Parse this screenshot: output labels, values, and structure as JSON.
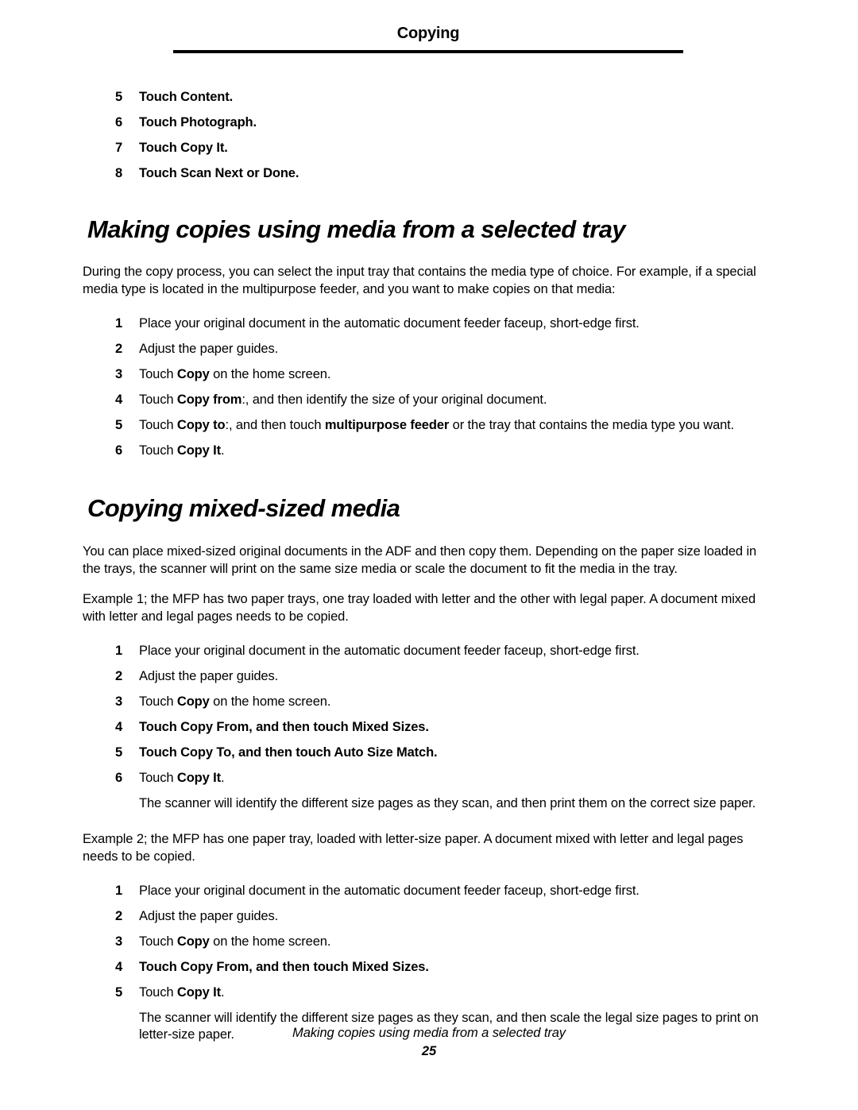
{
  "header": {
    "title": "Copying"
  },
  "top_steps": {
    "items": [
      {
        "num": "5",
        "parts": [
          {
            "t": "Touch ",
            "b": false
          },
          {
            "t": "Content",
            "b": true
          },
          {
            "t": ".",
            "b": false
          }
        ]
      },
      {
        "num": "6",
        "parts": [
          {
            "t": "Touch ",
            "b": false
          },
          {
            "t": "Photograph",
            "b": true
          },
          {
            "t": ".",
            "b": false
          }
        ]
      },
      {
        "num": "7",
        "parts": [
          {
            "t": "Touch ",
            "b": false
          },
          {
            "t": "Copy It",
            "b": true
          },
          {
            "t": ".",
            "b": false
          }
        ]
      },
      {
        "num": "8",
        "parts": [
          {
            "t": "Touch ",
            "b": true
          },
          {
            "t": "Scan Next",
            "b": true
          },
          {
            "t": " or ",
            "b": true
          },
          {
            "t": "Done",
            "b": true
          },
          {
            "t": ".",
            "b": true
          }
        ]
      }
    ]
  },
  "section_1": {
    "heading": "Making copies using media from a selected tray",
    "intro": "During the copy process, you can select the input tray that contains the media type of choice. For example, if a special media type is located in the multipurpose feeder, and you want to make copies on that media:",
    "steps": [
      {
        "num": "1",
        "parts": [
          {
            "t": "Place your original document in the automatic document feeder faceup, short-edge first.",
            "b": false
          }
        ]
      },
      {
        "num": "2",
        "parts": [
          {
            "t": "Adjust the paper guides.",
            "b": false
          }
        ]
      },
      {
        "num": "3",
        "parts": [
          {
            "t": "Touch ",
            "b": false
          },
          {
            "t": "Copy",
            "b": true
          },
          {
            "t": " on the home screen.",
            "b": false
          }
        ]
      },
      {
        "num": "4",
        "parts": [
          {
            "t": "Touch ",
            "b": false
          },
          {
            "t": "Copy from",
            "b": true
          },
          {
            "t": ":, and then identify the size of your original document.",
            "b": false
          }
        ]
      },
      {
        "num": "5",
        "parts": [
          {
            "t": "Touch ",
            "b": false
          },
          {
            "t": "Copy to",
            "b": true
          },
          {
            "t": ":, and then touch ",
            "b": false
          },
          {
            "t": "multipurpose feeder",
            "b": true
          },
          {
            "t": " or the tray that contains the media type you want.",
            "b": false
          }
        ]
      },
      {
        "num": "6",
        "parts": [
          {
            "t": "Touch ",
            "b": false
          },
          {
            "t": "Copy It",
            "b": true
          },
          {
            "t": ".",
            "b": false
          }
        ]
      }
    ]
  },
  "section_2": {
    "heading": "Copying mixed-sized media",
    "intro": "You can place mixed-sized original documents in the ADF and then copy them. Depending on the paper size loaded in the trays, the scanner will print on the same size media or scale the document to fit the media in the tray.",
    "example_1": {
      "paragraph": "Example 1; the MFP has two paper trays, one tray loaded with letter and the other with legal paper. A document mixed with letter and legal pages needs to be copied.",
      "steps": [
        {
          "num": "1",
          "parts": [
            {
              "t": "Place your original document in the automatic document feeder faceup, short-edge first.",
              "b": false
            }
          ]
        },
        {
          "num": "2",
          "parts": [
            {
              "t": "Adjust the paper guides.",
              "b": false
            }
          ]
        },
        {
          "num": "3",
          "parts": [
            {
              "t": "Touch ",
              "b": false
            },
            {
              "t": "Copy",
              "b": true
            },
            {
              "t": " on the home screen.",
              "b": false
            }
          ]
        },
        {
          "num": "4",
          "parts": [
            {
              "t": "Touch ",
              "b": true
            },
            {
              "t": "Copy From",
              "b": true
            },
            {
              "t": ", and then touch ",
              "b": true
            },
            {
              "t": "Mixed Sizes",
              "b": true
            },
            {
              "t": ".",
              "b": true
            }
          ]
        },
        {
          "num": "5",
          "parts": [
            {
              "t": "Touch ",
              "b": true
            },
            {
              "t": "Copy To",
              "b": true
            },
            {
              "t": ", and then touch ",
              "b": true
            },
            {
              "t": "Auto Size Match",
              "b": true
            },
            {
              "t": ".",
              "b": true
            }
          ]
        },
        {
          "num": "6",
          "parts": [
            {
              "t": "Touch ",
              "b": false
            },
            {
              "t": "Copy It",
              "b": true
            },
            {
              "t": ".",
              "b": false
            }
          ]
        }
      ],
      "note": "The scanner will identify the different size pages as they scan, and then print them on the correct size paper."
    },
    "example_2": {
      "paragraph": "Example 2; the MFP has one paper tray, loaded with letter-size paper. A document mixed with letter and legal pages needs to be copied.",
      "steps": [
        {
          "num": "1",
          "parts": [
            {
              "t": "Place your original document in the automatic document feeder faceup, short-edge first.",
              "b": false
            }
          ]
        },
        {
          "num": "2",
          "parts": [
            {
              "t": "Adjust the paper guides.",
              "b": false
            }
          ]
        },
        {
          "num": "3",
          "parts": [
            {
              "t": "Touch ",
              "b": false
            },
            {
              "t": "Copy",
              "b": true
            },
            {
              "t": " on the home screen.",
              "b": false
            }
          ]
        },
        {
          "num": "4",
          "parts": [
            {
              "t": "Touch ",
              "b": true
            },
            {
              "t": "Copy From",
              "b": true
            },
            {
              "t": ", and then touch ",
              "b": true
            },
            {
              "t": "Mixed Sizes",
              "b": true
            },
            {
              "t": ".",
              "b": true
            }
          ]
        },
        {
          "num": "5",
          "parts": [
            {
              "t": "Touch ",
              "b": false
            },
            {
              "t": "Copy It",
              "b": true
            },
            {
              "t": ".",
              "b": false
            }
          ]
        }
      ],
      "note": "The scanner will identify the different size pages as they scan, and then scale the legal size pages to print on letter-size paper."
    }
  },
  "footer": {
    "running_title": "Making copies using media from a selected tray",
    "page_number": "25"
  }
}
